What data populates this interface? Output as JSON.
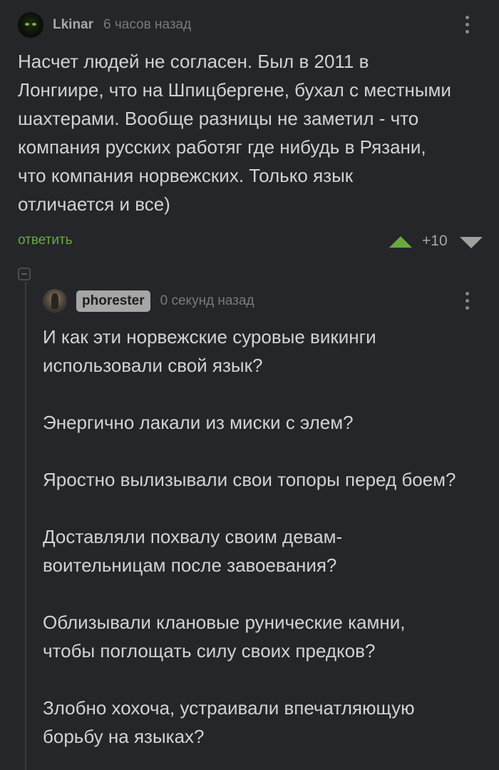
{
  "comment": {
    "author": "Lkinar",
    "time": "6 часов назад",
    "text": "Насчет людей не согласен. Был в 2011 в\nЛонгиире, что на Шпицбергене, бухал с местными\nшахтерами. Вообще разницы не заметил - что\nкомпания русских работяг где нибудь в Рязани,\nчто компания норвежских. Только язык\nотличается и все)",
    "reply_label": "ответить",
    "rating": "+10"
  },
  "reply": {
    "author": "phorester",
    "time": "0 секунд назад",
    "paragraphs": [
      "И как эти норвежские суровые викинги\nиспользовали свой язык?",
      "Энергично лакали из миски с элем?",
      "Яростно вылизывали свои топоры перед боем?",
      "Доставляли похвалу своим девам-\nвоительницам после завоевания?",
      "Облизывали клановые рунические камни,\nчтобы поглощать силу своих предков?",
      "Злобно хохоча, устраивали впечатляющую\nборьбу на языках?"
    ]
  },
  "colors": {
    "background": "#242629",
    "accent_green": "#6aa83f",
    "text": "#d2d2d2",
    "muted": "#7a7a7a"
  },
  "icons": [
    "kebab-menu-icon",
    "upvote-arrow-icon",
    "downvote-arrow-icon",
    "collapse-thread-icon"
  ]
}
